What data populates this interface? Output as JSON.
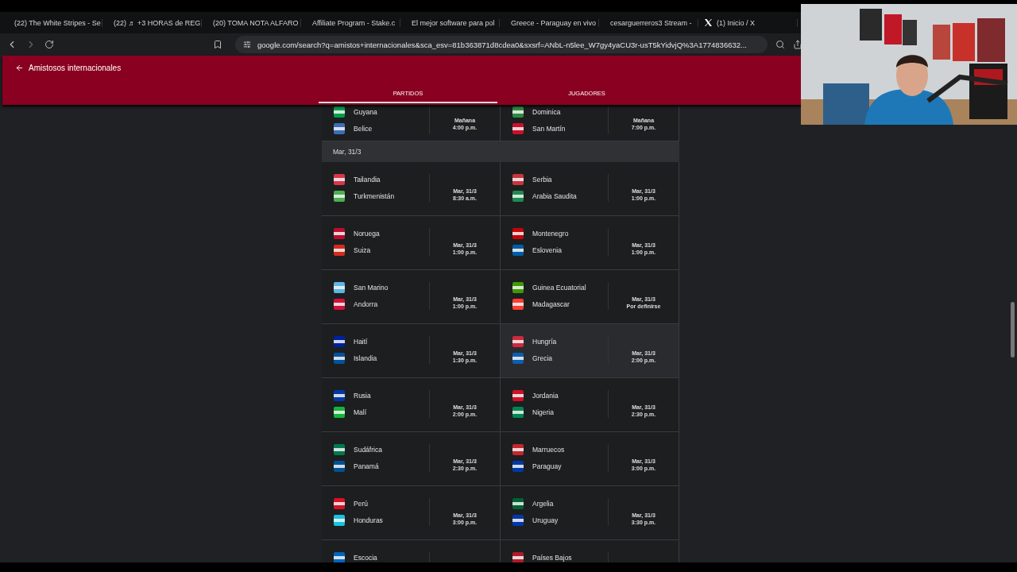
{
  "browser": {
    "tabs": [
      {
        "title": "(22) The White Stripes - Se",
        "kind": "youtube"
      },
      {
        "title": "(22) ♬ +3 HORAS de REG",
        "kind": "youtube"
      },
      {
        "title": "(20) TOMA NOTA ALFARO",
        "kind": "youtube"
      },
      {
        "title": "Affiliate Program - Stake.c",
        "kind": "stake"
      },
      {
        "title": "El mejor software para pol",
        "kind": "diamond"
      },
      {
        "title": "Greece - Paraguay en vivo",
        "kind": "stream"
      },
      {
        "title": "cesarguerreros3 Stream - ",
        "kind": "kick"
      },
      {
        "title": "(1) Inicio / X",
        "kind": "x"
      }
    ],
    "url": "google.com/search?q=amistos+internacionales&sca_esv=81b363871d8cdea0&sxsrf=ANbL-n5lee_W7gy4yaCU3r-usT5kYidvjQ%3A1774836632..."
  },
  "header": {
    "title": "Amistosos internacionales",
    "tabs": [
      {
        "label": "PARTIDOS",
        "selected": true
      },
      {
        "label": "JUGADORES",
        "selected": false
      }
    ]
  },
  "sections": [
    {
      "matches": [
        {
          "teams": [
            {
              "name": "Guyana",
              "color": "#009e49"
            },
            {
              "name": "Belice",
              "color": "#3a6fb5"
            }
          ],
          "date": "Mañana",
          "time": "4:00 p.m.",
          "highlighted": false
        },
        {
          "teams": [
            {
              "name": "Dominica",
              "color": "#2e8b3e"
            },
            {
              "name": "San Martín",
              "color": "#c8102e"
            }
          ],
          "date": "Mañana",
          "time": "7:00 p.m.",
          "highlighted": false
        }
      ]
    },
    {
      "heading": "Mar, 31/3",
      "matches": [
        {
          "teams": [
            {
              "name": "Tailandia",
              "color": "#d9364a"
            },
            {
              "name": "Turkmenistán",
              "color": "#4caf50"
            }
          ],
          "date": "Mar, 31/3",
          "time": "8:30 a.m.",
          "highlighted": false
        },
        {
          "teams": [
            {
              "name": "Serbia",
              "color": "#c6363c"
            },
            {
              "name": "Arabia Saudita",
              "color": "#1f8a50"
            }
          ],
          "date": "Mar, 31/3",
          "time": "1:00 p.m.",
          "highlighted": false
        },
        {
          "teams": [
            {
              "name": "Noruega",
              "color": "#ba0c2f"
            },
            {
              "name": "Suiza",
              "color": "#d52b1e"
            }
          ],
          "date": "Mar, 31/3",
          "time": "1:00 p.m.",
          "highlighted": false
        },
        {
          "teams": [
            {
              "name": "Montenegro",
              "color": "#c40308"
            },
            {
              "name": "Eslovenia",
              "color": "#005da4"
            }
          ],
          "date": "Mar, 31/3",
          "time": "1:00 p.m.",
          "highlighted": false
        },
        {
          "teams": [
            {
              "name": "San Marino",
              "color": "#5eb6e4"
            },
            {
              "name": "Andorra",
              "color": "#d0103a"
            }
          ],
          "date": "Mar, 31/3",
          "time": "1:00 p.m.",
          "highlighted": false
        },
        {
          "teams": [
            {
              "name": "Guinea Ecuatorial",
              "color": "#3e9a00"
            },
            {
              "name": "Madagascar",
              "color": "#fc3d32"
            }
          ],
          "date": "Mar, 31/3",
          "time": "Por definirse",
          "highlighted": false
        },
        {
          "teams": [
            {
              "name": "Haití",
              "color": "#00209f"
            },
            {
              "name": "Islandia",
              "color": "#02529c"
            }
          ],
          "date": "Mar, 31/3",
          "time": "1:30 p.m.",
          "highlighted": false
        },
        {
          "teams": [
            {
              "name": "Hungría",
              "color": "#cd2a3e"
            },
            {
              "name": "Grecia",
              "color": "#0d5eaf"
            }
          ],
          "date": "Mar, 31/3",
          "time": "2:00 p.m.",
          "highlighted": true
        },
        {
          "teams": [
            {
              "name": "Rusia",
              "color": "#0039a6"
            },
            {
              "name": "Malí",
              "color": "#14b53a"
            }
          ],
          "date": "Mar, 31/3",
          "time": "2:00 p.m.",
          "highlighted": false
        },
        {
          "teams": [
            {
              "name": "Jordania",
              "color": "#ce1126"
            },
            {
              "name": "Nigeria",
              "color": "#008751"
            }
          ],
          "date": "Mar, 31/3",
          "time": "2:30 p.m.",
          "highlighted": false
        },
        {
          "teams": [
            {
              "name": "Sudáfrica",
              "color": "#007a4d"
            },
            {
              "name": "Panamá",
              "color": "#005293"
            }
          ],
          "date": "Mar, 31/3",
          "time": "2:30 p.m.",
          "highlighted": false
        },
        {
          "teams": [
            {
              "name": "Marruecos",
              "color": "#c1272d"
            },
            {
              "name": "Paraguay",
              "color": "#0038a8"
            }
          ],
          "date": "Mar, 31/3",
          "time": "3:00 p.m.",
          "highlighted": false
        },
        {
          "teams": [
            {
              "name": "Perú",
              "color": "#d91023"
            },
            {
              "name": "Honduras",
              "color": "#18c3df"
            }
          ],
          "date": "Mar, 31/3",
          "time": "3:00 p.m.",
          "highlighted": false
        },
        {
          "teams": [
            {
              "name": "Argelia",
              "color": "#006233"
            },
            {
              "name": "Uruguay",
              "color": "#0038a8"
            }
          ],
          "date": "Mar, 31/3",
          "time": "3:30 p.m.",
          "highlighted": false
        },
        {
          "teams": [
            {
              "name": "Escocia",
              "color": "#0065bd"
            }
          ],
          "highlighted": false
        },
        {
          "teams": [
            {
              "name": "Países Bajos",
              "color": "#ae1c28"
            }
          ],
          "highlighted": false
        }
      ]
    }
  ]
}
